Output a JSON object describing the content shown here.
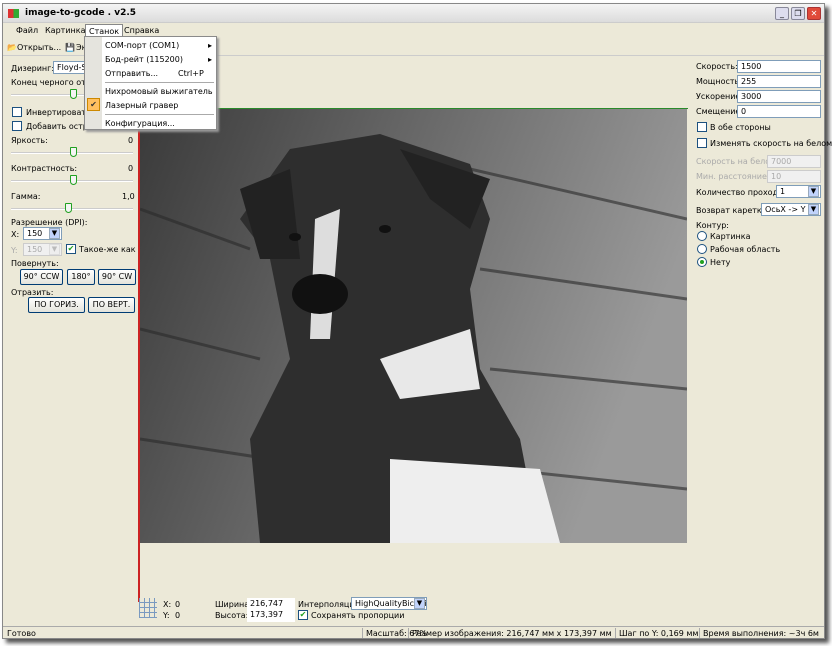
{
  "window": {
    "title": "image-to-gcode . v2.5",
    "controls": [
      "minimize",
      "restore",
      "close"
    ]
  },
  "menubar": {
    "items": [
      "Файл",
      "Картинка",
      "Станок",
      "Справка"
    ],
    "active": "Станок"
  },
  "toolbar": {
    "open_label": "Открыть...",
    "export_label": "Экспорт..."
  },
  "machine_menu": {
    "items": [
      {
        "label": "COM-порт (COM1)",
        "submenu": true
      },
      {
        "label": "Бод-рейт (115200)",
        "submenu": true
      },
      {
        "label": "Отправить...",
        "shortcut": "Ctrl+P"
      },
      {
        "label": "Нихромовый выжигатель"
      },
      {
        "label": "Лазерный гравер",
        "checked": true
      },
      {
        "label": "Конфигурация..."
      }
    ]
  },
  "left": {
    "dithering_label": "Дизеринг:",
    "dithering_value": "Floyd-Steinberg",
    "black_end_label": "Конец черного оттенка:",
    "black_end_level": 0.38,
    "invert_label": "Инвертировать цвета",
    "invert_checked": false,
    "sharpen_label": "Добавить остроты",
    "sharpen_checked": false,
    "brightness_label": "Яркость:",
    "brightness_value": "0",
    "brightness_level": 0.5,
    "contrast_label": "Контрастность:",
    "contrast_value": "0",
    "contrast_level": 0.5,
    "gamma_label": "Гамма:",
    "gamma_value": "1,0",
    "gamma_level": 0.45,
    "dpi_label": "Разрешение (DPI):",
    "x_label": "X:",
    "x_value": "150",
    "y_label": "Y:",
    "y_value": "150",
    "same_as_x_label": "Такое-же как X",
    "same_as_x_checked": true,
    "rotate_label": "Повернуть:",
    "rotate_buttons": [
      "90° CCW",
      "180°",
      "90° CW"
    ],
    "mirror_label": "Отразить:",
    "mirror_buttons": [
      "ПО ГОРИЗ.",
      "ПО ВЕРТ."
    ]
  },
  "right": {
    "speed_label": "Скорость:",
    "speed_value": "1500",
    "power_label": "Мощность:",
    "power_value": "255",
    "accel_label": "Ускорение:",
    "accel_value": "3000",
    "offset_label": "Смещение:",
    "offset_value": "0",
    "both_sides_label": "В обе стороны",
    "both_sides_checked": false,
    "change_speed_label": "Изменять скорость на белом",
    "change_speed_checked": false,
    "white_speed_label": "Скорость на белом:",
    "white_speed_value": "7000",
    "min_dist_label": "Мин. расстояние:",
    "min_dist_value": "10",
    "passes_label": "Количество проходов:",
    "passes_value": "1",
    "carriage_label": "Возврат каретки:",
    "carriage_value": "ОсьX -> Y",
    "contour_label": "Контур:",
    "contour_options": [
      "Картинка",
      "Рабочая область",
      "Нету"
    ],
    "contour_selected": "Нету"
  },
  "bottom": {
    "x_label": "X:",
    "x_value": "0",
    "y_label": "Y:",
    "y_value": "0",
    "width_label": "Ширина:",
    "width_value": "216,747",
    "height_label": "Высота:",
    "height_value": "173,397",
    "interp_label": "Интерполяция:",
    "interp_value": "HighQualityBicubic",
    "keep_ratio_label": "Сохранять пропорции",
    "keep_ratio_checked": true
  },
  "status": {
    "ready": "Готово",
    "scale": "Масштаб: 67%",
    "size": "Размер изображения: 216,747 мм x 173,397 мм",
    "step": "Шаг по Y: 0,169 мм",
    "time": "Время выполнения: ~3ч 6м"
  },
  "colors": {
    "accent_check": "#21a121",
    "axis_x": "#2a8a2a",
    "axis_y": "#cc2222",
    "close": "#e04a3a"
  }
}
